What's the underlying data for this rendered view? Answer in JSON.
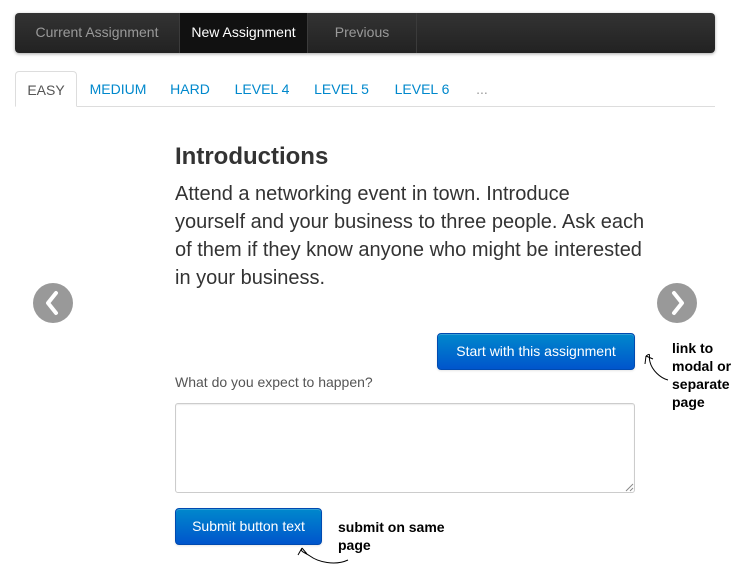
{
  "navbar": {
    "items": [
      {
        "label": "Current Assignment",
        "active": false
      },
      {
        "label": "New Assignment",
        "active": true
      },
      {
        "label": "Previous",
        "active": false
      }
    ]
  },
  "tabs": [
    {
      "label": "EASY",
      "active": true
    },
    {
      "label": "MEDIUM",
      "active": false
    },
    {
      "label": "HARD",
      "active": false
    },
    {
      "label": "LEVEL 4",
      "active": false
    },
    {
      "label": "LEVEL 5",
      "active": false
    },
    {
      "label": "LEVEL 6",
      "active": false
    },
    {
      "label": "...",
      "active": false
    }
  ],
  "assignment": {
    "title": "Introductions",
    "description": "Attend a networking event in town. Introduce yourself and your business to three people. Ask each of them if they know anyone who might be interested in your business."
  },
  "carousel": {
    "prev_icon": "chevron-left-icon",
    "next_icon": "chevron-right-icon"
  },
  "start_button": {
    "label": "Start with this assignment"
  },
  "expectation": {
    "label": "What do you expect to happen?",
    "value": "",
    "placeholder": ""
  },
  "submit_button": {
    "label": "Submit button text"
  },
  "annotations": {
    "start_note": "link to\nmodal or\nseparate\npage",
    "submit_note": "submit on same\npage"
  },
  "colors": {
    "navbar": "#222222",
    "link": "#0088cc",
    "primary": "#0066cc",
    "carousel_control": "#999999"
  }
}
